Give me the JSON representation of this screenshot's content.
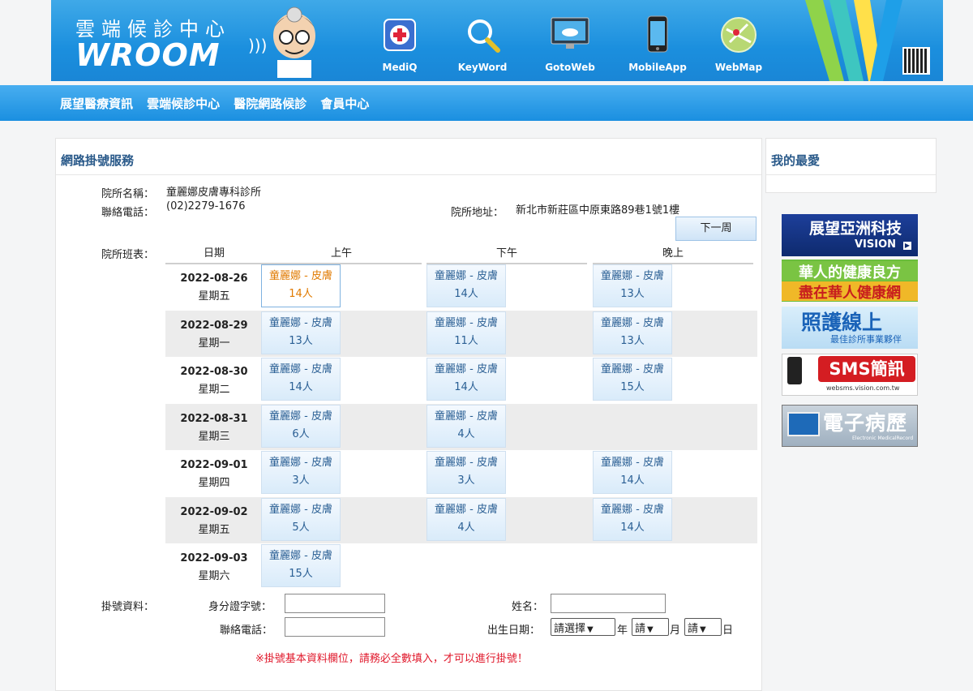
{
  "banner": {
    "brand_cn": "雲端候診中心",
    "brand_en": "WROOM",
    "nav": [
      {
        "label": "MediQ",
        "icon": "mediq-icon"
      },
      {
        "label": "KeyWord",
        "icon": "magnifier-icon"
      },
      {
        "label": "GotoWeb",
        "icon": "monitor-cloud-icon"
      },
      {
        "label": "MobileApp",
        "icon": "smartphone-icon"
      },
      {
        "label": "WebMap",
        "icon": "map-icon"
      }
    ]
  },
  "menu": [
    "展望醫療資訊",
    "雲端候診中心",
    "醫院網路候診",
    "會員中心"
  ],
  "main": {
    "title": "網路掛號服務",
    "clinic_name_label": "院所名稱：",
    "clinic_name": "童麗娜皮膚專科診所",
    "phone_label": "聯絡電話：",
    "phone": "(02)2279-1676",
    "address_label": "院所地址：",
    "address": "新北市新莊區中原東路89巷1號1樓",
    "next_week": "下一周",
    "schedule_label": "院所班表：",
    "col_date": "日期",
    "col_am": "上午",
    "col_pm": "下午",
    "col_eve": "晚上"
  },
  "schedule": [
    {
      "date": "2022-08-26",
      "weekday": "星期五",
      "am": {
        "doctor": "童麗娜 - 皮膚",
        "count": "14人"
      },
      "pm": {
        "doctor": "童麗娜 - 皮膚",
        "count": "14人"
      },
      "eve": {
        "doctor": "童麗娜 - 皮膚",
        "count": "13人"
      }
    },
    {
      "date": "2022-08-29",
      "weekday": "星期一",
      "am": {
        "doctor": "童麗娜 - 皮膚",
        "count": "13人"
      },
      "pm": {
        "doctor": "童麗娜 - 皮膚",
        "count": "11人"
      },
      "eve": {
        "doctor": "童麗娜 - 皮膚",
        "count": "13人"
      }
    },
    {
      "date": "2022-08-30",
      "weekday": "星期二",
      "am": {
        "doctor": "童麗娜 - 皮膚",
        "count": "14人"
      },
      "pm": {
        "doctor": "童麗娜 - 皮膚",
        "count": "14人"
      },
      "eve": {
        "doctor": "童麗娜 - 皮膚",
        "count": "15人"
      }
    },
    {
      "date": "2022-08-31",
      "weekday": "星期三",
      "am": {
        "doctor": "童麗娜 - 皮膚",
        "count": "6人"
      },
      "pm": {
        "doctor": "童麗娜 - 皮膚",
        "count": "4人"
      },
      "eve": null
    },
    {
      "date": "2022-09-01",
      "weekday": "星期四",
      "am": {
        "doctor": "童麗娜 - 皮膚",
        "count": "3人"
      },
      "pm": {
        "doctor": "童麗娜 - 皮膚",
        "count": "3人"
      },
      "eve": {
        "doctor": "童麗娜 - 皮膚",
        "count": "14人"
      }
    },
    {
      "date": "2022-09-02",
      "weekday": "星期五",
      "am": {
        "doctor": "童麗娜 - 皮膚",
        "count": "5人"
      },
      "pm": {
        "doctor": "童麗娜 - 皮膚",
        "count": "4人"
      },
      "eve": {
        "doctor": "童麗娜 - 皮膚",
        "count": "14人"
      }
    },
    {
      "date": "2022-09-03",
      "weekday": "星期六",
      "am": {
        "doctor": "童麗娜 - 皮膚",
        "count": "15人"
      },
      "pm": null,
      "eve": null
    }
  ],
  "form": {
    "section_label": "掛號資料：",
    "id_label": "身分證字號：",
    "name_label": "姓名：",
    "tel_label": "聯絡電話：",
    "birth_label": "出生日期：",
    "year_select": "請選擇",
    "year_unit": "年",
    "month_select": "請",
    "month_unit": "月",
    "day_select": "請",
    "day_unit": "日",
    "warning": "※掛號基本資料欄位，請務必全數填入，才可以進行掛號！"
  },
  "sidebar": {
    "title": "我的最愛",
    "ads": [
      {
        "line1": "展望亞洲科技",
        "line2": "VISION"
      },
      {
        "line1": "華人的健康良方",
        "line2": "盡在華人健康網"
      },
      {
        "line1": "照護線上",
        "line2": "最佳診所事業夥伴"
      },
      {
        "line1": "SMS簡訊",
        "line2": "websms.vision.com.tw"
      },
      {
        "line1": "電子病歷",
        "line2": "Electronic MedicalRecord"
      }
    ]
  },
  "colors": {
    "accent": "#1a8fe0",
    "warning": "#e0182b",
    "active_slot": "#e07a00",
    "slot_text": "#2a5f94"
  }
}
